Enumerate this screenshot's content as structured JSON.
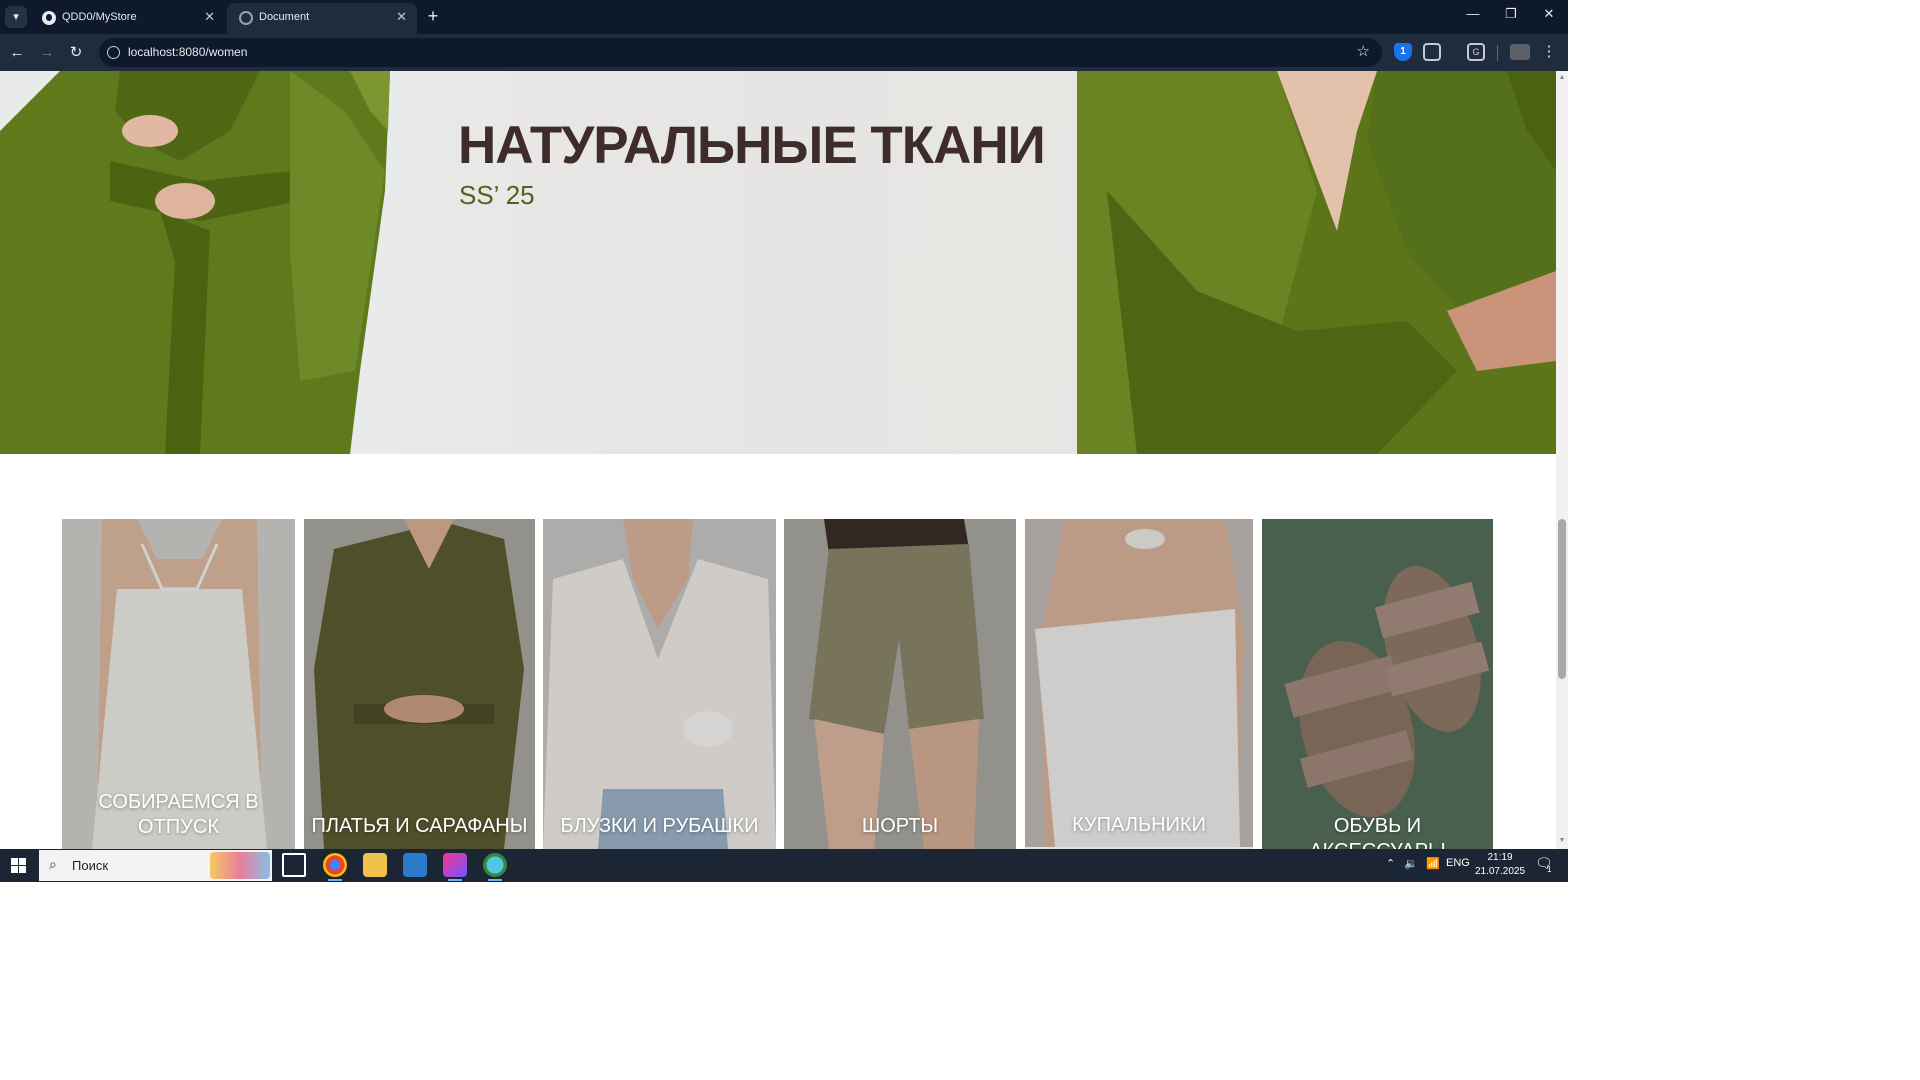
{
  "browser": {
    "tabs": [
      {
        "title": "QDD0/MyStore",
        "active": false
      },
      {
        "title": "Document",
        "active": true
      }
    ],
    "url": "localhost:8080/women"
  },
  "hero": {
    "title": "НАТУРАЛЬНЫЕ ТКАНИ",
    "subtitle": "SS’ 25"
  },
  "categories": [
    {
      "label": "СОБИРАЕМСЯ В ОТПУСК",
      "color": "#c9c7c4"
    },
    {
      "label": "ПЛАТЬЯ И САРАФАНЫ",
      "color": "#5e5d35"
    },
    {
      "label": "БЛУЗКИ И РУБАШКИ",
      "color": "#c9c2bc"
    },
    {
      "label": "ШОРТЫ",
      "color": "#8a8a73"
    },
    {
      "label": "КУПАЛЬНИКИ",
      "color": "#b8b3ad"
    },
    {
      "label": "ОБУВЬ И АКСЕССУАРЫ",
      "color": "#4f6a55"
    }
  ],
  "taskbar": {
    "search_placeholder": "Поиск",
    "language": "ENG",
    "time": "21:19",
    "date": "21.07.2025",
    "notification_count": "1"
  },
  "colors": {
    "hero_title": "#3e2c2c",
    "hero_subtitle": "#55601f",
    "linen_green": "#5a7418"
  }
}
